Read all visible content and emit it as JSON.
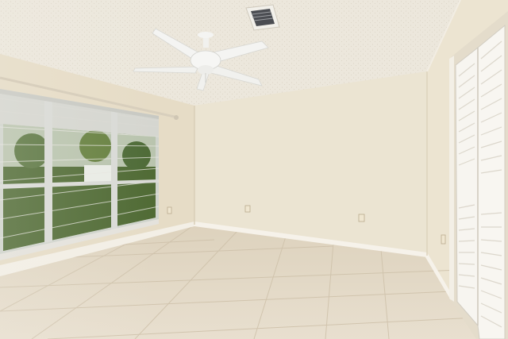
{
  "scene": {
    "subject": "empty-room",
    "colors": {
      "ceiling": "#ece7dc",
      "back_wall": "#ebe4d2",
      "left_wall": "#e6dcc6",
      "right_wall": "#ece4d1",
      "floor": "#e2d7c4",
      "tile_grout": "#cfc2ab",
      "baseboard": "#f6f2ea",
      "window_frame": "#d9dad6",
      "foliage": "#4f6a34",
      "closet_door": "#f7f5f0",
      "fan": "#f4f4f2"
    },
    "icons": [
      "ceiling-fan-icon",
      "air-vent-icon",
      "electrical-outlet-icon",
      "closet-door-icon",
      "window-blinds-icon"
    ]
  }
}
